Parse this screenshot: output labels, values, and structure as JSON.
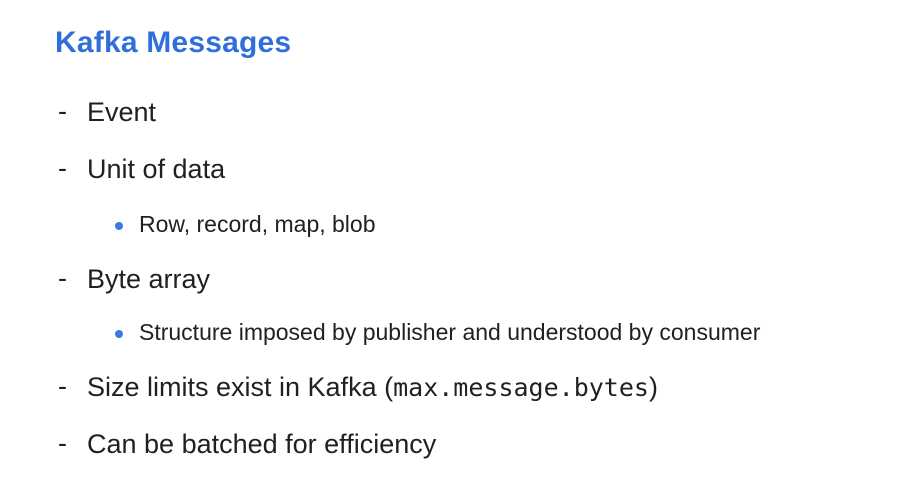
{
  "slide": {
    "title": "Kafka Messages",
    "items": [
      {
        "marker": "-",
        "text": "Event"
      },
      {
        "marker": "-",
        "text": "Unit of data",
        "subitems": [
          {
            "text": "Row, record, map, blob"
          }
        ]
      },
      {
        "marker": "-",
        "text": "Byte array",
        "subitems": [
          {
            "text": "Structure imposed by publisher and understood by consumer"
          }
        ]
      },
      {
        "marker": "-",
        "text_before": "Size limits exist in Kafka (",
        "code": "max.message.bytes",
        "text_after": ")"
      },
      {
        "marker": "-",
        "text": "Can be batched for efficiency"
      }
    ],
    "colors": {
      "title": "#2f6fdc",
      "bullet": "#3c78e0",
      "text": "#1f1f24"
    }
  }
}
